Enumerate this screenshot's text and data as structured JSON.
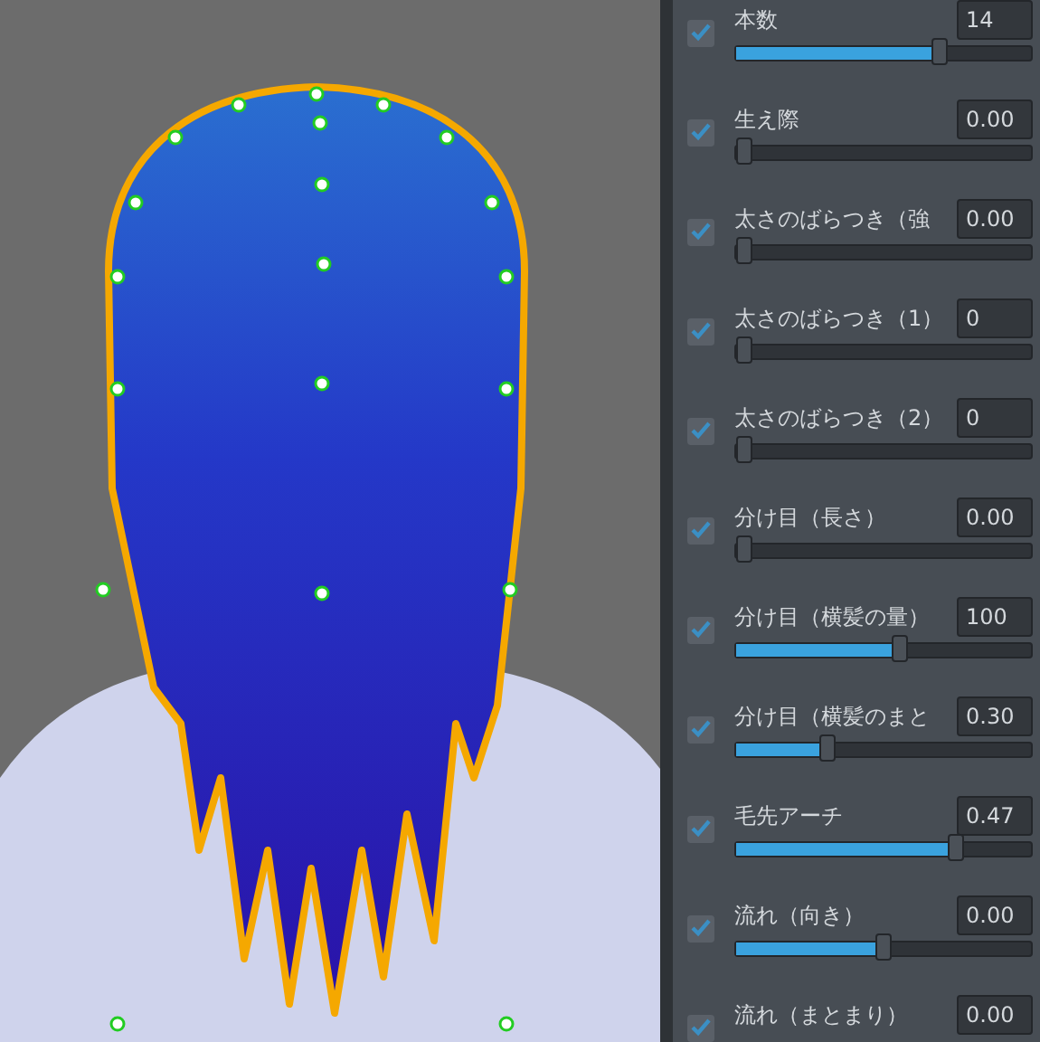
{
  "params": [
    {
      "label": "本数",
      "value": "14",
      "checked": true,
      "level": 0.7
    },
    {
      "label": "生え際",
      "value": "0.00",
      "checked": true,
      "level": 0
    },
    {
      "label": "太さのばらつき（強",
      "value": "0.00",
      "checked": true,
      "level": 0
    },
    {
      "label": "太さのばらつき（1）",
      "value": "0",
      "checked": true,
      "level": 0
    },
    {
      "label": "太さのばらつき（2）",
      "value": "0",
      "checked": true,
      "level": 0
    },
    {
      "label": "分け目（長さ）",
      "value": "0.00",
      "checked": true,
      "level": 0
    },
    {
      "label": "分け目（横髪の量）",
      "value": "100",
      "checked": true,
      "level": 0.56
    },
    {
      "label": "分け目（横髪のまと",
      "value": "0.30",
      "checked": true,
      "level": 0.3
    },
    {
      "label": "毛先アーチ",
      "value": "0.47",
      "checked": true,
      "level": 0.76
    },
    {
      "label": "流れ（向き）",
      "value": "0.00",
      "checked": true,
      "level": 0.5
    },
    {
      "label": "流れ（まとまり）",
      "value": "0.00",
      "checked": true
    }
  ]
}
